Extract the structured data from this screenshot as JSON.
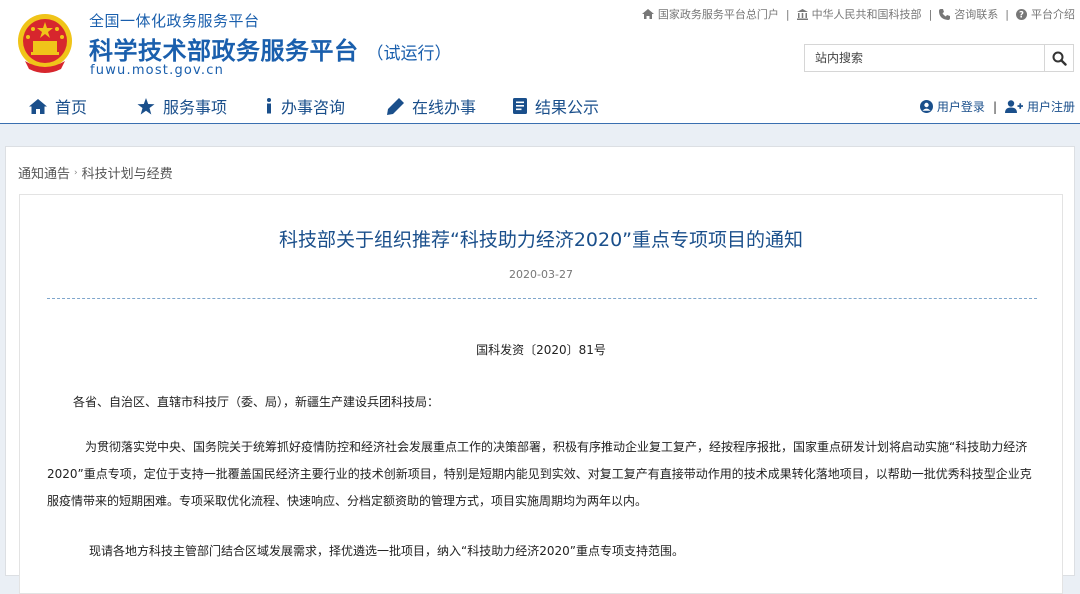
{
  "header": {
    "brand_top": "全国一体化政务服务平台",
    "brand_title": "科学技术部政务服务平台",
    "brand_trial": "（试运行）",
    "brand_domain": "fuwu.most.gov.cn",
    "toplinks": [
      {
        "label": "国家政务服务平台总门户",
        "icon": "home-icon"
      },
      {
        "label": "中华人民共和国科技部",
        "icon": "building-icon"
      },
      {
        "label": "咨询联系",
        "icon": "phone-icon"
      },
      {
        "label": "平台介绍",
        "icon": "question-icon"
      }
    ],
    "search": {
      "placeholder": "站内搜索",
      "icon": "search-icon"
    },
    "nav": [
      {
        "label": "首页",
        "icon": "home-icon"
      },
      {
        "label": "服务事项",
        "icon": "star-icon"
      },
      {
        "label": "办事咨询",
        "icon": "info-icon"
      },
      {
        "label": "在线办事",
        "icon": "pencil-icon"
      },
      {
        "label": "结果公示",
        "icon": "document-icon"
      }
    ],
    "user": {
      "login": "用户登录",
      "register": "用户注册"
    }
  },
  "breadcrumb": [
    "通知通告",
    "科技计划与经费"
  ],
  "article": {
    "title": "科技部关于组织推荐“科技助力经济2020”重点专项项目的通知",
    "date": "2020-03-27",
    "doc_number": "国科发资〔2020〕81号",
    "greeting": "各省、自治区、直辖市科技厅（委、局），新疆生产建设兵团科技局：",
    "para1": "为贯彻落实党中央、国务院关于统筹抓好疫情防控和经济社会发展重点工作的决策部署，积极有序推动企业复工复产，经按程序报批，国家重点研发计划将启动实施“科技助力经济2020”重点专项，定位于支持一批覆盖国民经济主要行业的技术创新项目，特别是短期内能见到实效、对复工复产有直接带动作用的技术成果转化落地项目，以帮助一批优秀科技型企业克服疫情带来的短期困难。专项采取优化流程、快速响应、分档定额资助的管理方式，项目实施周期均为两年以内。",
    "para2": "现请各地方科技主管部门结合区域发展需求，择优遴选一批项目，纳入“科技助力经济2020”重点专项支持范围。"
  },
  "colors": {
    "brand": "#1a5fad",
    "nav": "#1a4f8b",
    "emblem_red": "#d7262d",
    "emblem_gold": "#f0c419"
  }
}
